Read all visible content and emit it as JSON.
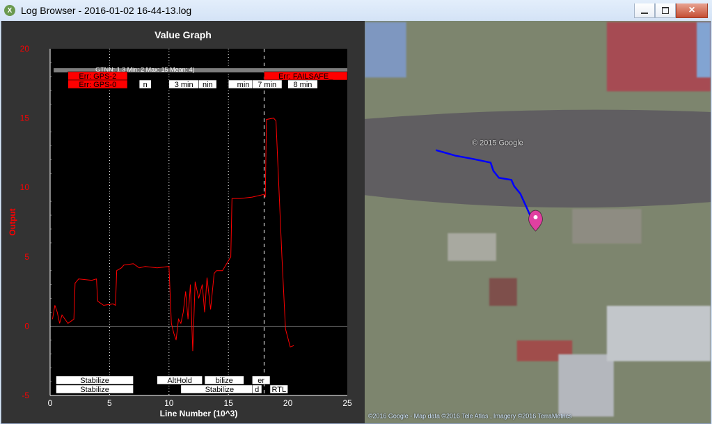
{
  "window": {
    "title": "Log Browser - 2016-01-02 16-44-13.log",
    "icon_letter": "X"
  },
  "controls": {
    "minimize_icon": "minimize-icon",
    "maximize_icon": "maximize-icon",
    "close_icon": "close-icon"
  },
  "graph_panel": {
    "chart_data": {
      "title": "Value Graph",
      "xlabel": "Line Number (10^3)",
      "ylabel": "Output",
      "xlim": [
        0,
        25
      ],
      "ylim": [
        -5,
        20
      ],
      "x_ticks": [
        0,
        5,
        10,
        15,
        20,
        25
      ],
      "y_ticks": [
        -5,
        0,
        5,
        10,
        15,
        20
      ],
      "series": [
        {
          "name": "Output",
          "color": "#ff0000",
          "values": [
            {
              "x": 0.2,
              "y": 0.5
            },
            {
              "x": 0.4,
              "y": 1.5
            },
            {
              "x": 0.6,
              "y": 1.0
            },
            {
              "x": 0.8,
              "y": 0.2
            },
            {
              "x": 1.0,
              "y": 0.8
            },
            {
              "x": 1.5,
              "y": 0.2
            },
            {
              "x": 2.0,
              "y": 0.5
            },
            {
              "x": 2.1,
              "y": 3.1
            },
            {
              "x": 2.4,
              "y": 3.4
            },
            {
              "x": 3.5,
              "y": 3.3
            },
            {
              "x": 3.9,
              "y": 3.4
            },
            {
              "x": 4.0,
              "y": 1.8
            },
            {
              "x": 4.5,
              "y": 1.5
            },
            {
              "x": 5.3,
              "y": 1.6
            },
            {
              "x": 5.5,
              "y": 1.5
            },
            {
              "x": 5.6,
              "y": 4.0
            },
            {
              "x": 6.0,
              "y": 4.2
            },
            {
              "x": 6.2,
              "y": 4.4
            },
            {
              "x": 7.0,
              "y": 4.5
            },
            {
              "x": 7.5,
              "y": 4.2
            },
            {
              "x": 8.0,
              "y": 4.3
            },
            {
              "x": 9.0,
              "y": 4.2
            },
            {
              "x": 10.0,
              "y": 4.3
            },
            {
              "x": 10.2,
              "y": 0.2
            },
            {
              "x": 10.4,
              "y": -0.5
            },
            {
              "x": 10.6,
              "y": -1.0
            },
            {
              "x": 10.8,
              "y": 0.5
            },
            {
              "x": 11.0,
              "y": 0.2
            },
            {
              "x": 11.2,
              "y": 1.0
            },
            {
              "x": 11.4,
              "y": 2.5
            },
            {
              "x": 11.6,
              "y": 0.5
            },
            {
              "x": 11.8,
              "y": 3.0
            },
            {
              "x": 12.0,
              "y": -1.8
            },
            {
              "x": 12.2,
              "y": 3.2
            },
            {
              "x": 12.5,
              "y": 2.0
            },
            {
              "x": 12.8,
              "y": 3.0
            },
            {
              "x": 13.0,
              "y": 1.0
            },
            {
              "x": 13.2,
              "y": 3.5
            },
            {
              "x": 13.5,
              "y": 1.2
            },
            {
              "x": 13.8,
              "y": 3.8
            },
            {
              "x": 14.0,
              "y": 4.0
            },
            {
              "x": 14.5,
              "y": 4.0
            },
            {
              "x": 15.2,
              "y": 5.0
            },
            {
              "x": 15.3,
              "y": 9.2
            },
            {
              "x": 16.0,
              "y": 9.2
            },
            {
              "x": 17.0,
              "y": 9.3
            },
            {
              "x": 18.0,
              "y": 9.5
            },
            {
              "x": 18.1,
              "y": 9.3
            },
            {
              "x": 18.2,
              "y": 14.9
            },
            {
              "x": 18.8,
              "y": 15.0
            },
            {
              "x": 19.0,
              "y": 14.8
            },
            {
              "x": 19.5,
              "y": 5.0
            },
            {
              "x": 19.8,
              "y": -0.2
            },
            {
              "x": 20.2,
              "y": -1.5
            },
            {
              "x": 20.5,
              "y": -1.4
            }
          ]
        }
      ],
      "dotted_vlines": [
        5.0,
        10.0,
        15.0
      ],
      "dashed_vlines": [
        18.0
      ],
      "mode_changes": {
        "row1": [
          {
            "x": 0.5,
            "label": "Stabilize",
            "width": 6.5
          },
          {
            "x": 9.0,
            "label": "AltHold",
            "width": 3.8
          },
          {
            "x": 13.0,
            "label": "bilize",
            "width": 3.3
          },
          {
            "x": 17.0,
            "label": "er",
            "width": 1.5
          }
        ],
        "row2": [
          {
            "x": 0.5,
            "label": "Stabilize",
            "width": 6.5
          },
          {
            "x": 11.0,
            "label": "Stabilize",
            "width": 6.5
          },
          {
            "x": 17.0,
            "label": "d",
            "width": 0.8
          },
          {
            "x": 18.5,
            "label": "RTL",
            "width": 1.5
          }
        ]
      },
      "events": {
        "header": {
          "label": "GTNN: 1.3 Min: 2 Max: 15 Mean: 4)",
          "x": 0.3
        },
        "row1": [
          {
            "label": "Err: GPS-2",
            "x": 1.5,
            "width": 5.0
          },
          {
            "label": "Err: FAILSAFE_",
            "x": 18.0,
            "width": 7.0
          }
        ],
        "row2": [
          {
            "label": "Err: GPS-0",
            "x": 1.5,
            "width": 5.0
          },
          {
            "label": "n",
            "x": 7.5,
            "width": 1.0
          },
          {
            "label": "3 min",
            "x": 10.0,
            "width": 2.5
          },
          {
            "label": "nin",
            "x": 12.5,
            "width": 1.5
          },
          {
            "label": "min",
            "x": 15.0,
            "width": 2.5
          },
          {
            "label": "7 min",
            "x": 17.0,
            "width": 2.5
          },
          {
            "label": "8 min",
            "x": 20.0,
            "width": 2.5
          }
        ]
      }
    }
  },
  "map_panel": {
    "watermark": "© 2015 Google",
    "copyright": "©2016 Google - Map data ©2016 Tele Atlas , Imagery ©2016 TerraMetrics",
    "path_color": "#0000ff",
    "pin_color": "#e040a0",
    "path": [
      [
        103,
        185
      ],
      [
        131,
        193
      ],
      [
        158,
        198
      ],
      [
        182,
        203
      ],
      [
        186,
        215
      ],
      [
        194,
        225
      ],
      [
        212,
        228
      ],
      [
        216,
        237
      ],
      [
        225,
        248
      ],
      [
        235,
        270
      ],
      [
        243,
        288
      ],
      [
        246,
        293
      ],
      [
        249,
        293
      ]
    ],
    "pin": [
      247,
      292
    ]
  }
}
